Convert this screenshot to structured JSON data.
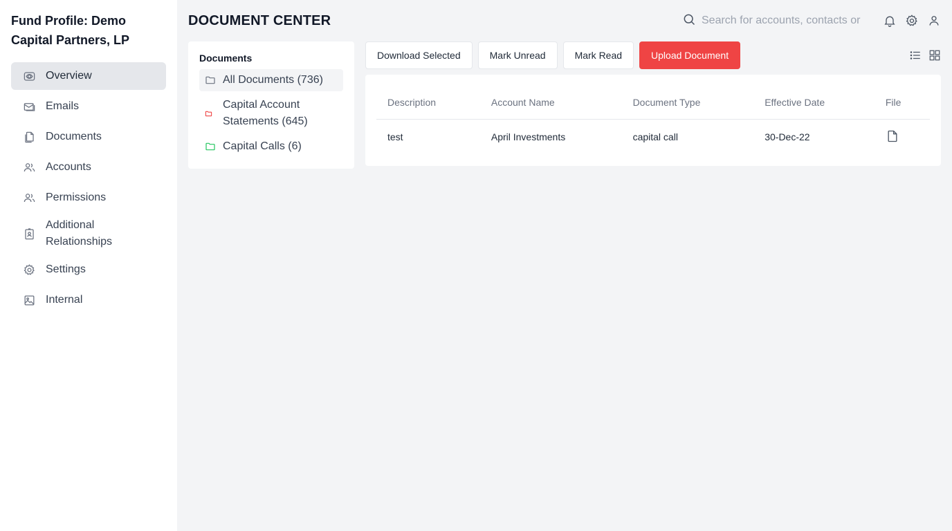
{
  "sidebar": {
    "fund_title": "Fund Profile: Demo Capital Partners, LP",
    "items": [
      {
        "label": "Overview",
        "icon": "eye-icon"
      },
      {
        "label": "Emails",
        "icon": "mail-icon"
      },
      {
        "label": "Documents",
        "icon": "documents-icon"
      },
      {
        "label": "Accounts",
        "icon": "users-icon"
      },
      {
        "label": "Permissions",
        "icon": "users-icon"
      },
      {
        "label": "Additional Relationships",
        "icon": "contact-card-icon"
      },
      {
        "label": "Settings",
        "icon": "gear-icon"
      },
      {
        "label": "Internal",
        "icon": "image-icon"
      }
    ],
    "active_index": 0
  },
  "header": {
    "title": "DOCUMENT CENTER",
    "search_placeholder": "Search for accounts, contacts or"
  },
  "folders": {
    "heading": "Documents",
    "items": [
      {
        "label": "All Documents (736)",
        "color": "#6b7280"
      },
      {
        "label": "Capital Account Statements (645)",
        "color": "#ef4444"
      },
      {
        "label": "Capital Calls (6)",
        "color": "#22c55e"
      }
    ]
  },
  "toolbar": {
    "download_selected": "Download Selected",
    "mark_unread": "Mark Unread",
    "mark_read": "Mark Read",
    "upload_document": "Upload Document"
  },
  "table": {
    "columns": [
      "Description",
      "Account Name",
      "Document Type",
      "Effective Date",
      "File"
    ],
    "rows": [
      {
        "description": "test",
        "account_name": "April Investments",
        "document_type": "capital call",
        "effective_date": "30-Dec-22"
      }
    ]
  },
  "colors": {
    "accent": "#ef4444",
    "sidebar_active_bg": "#e5e7eb",
    "page_bg": "#f3f4f6"
  }
}
